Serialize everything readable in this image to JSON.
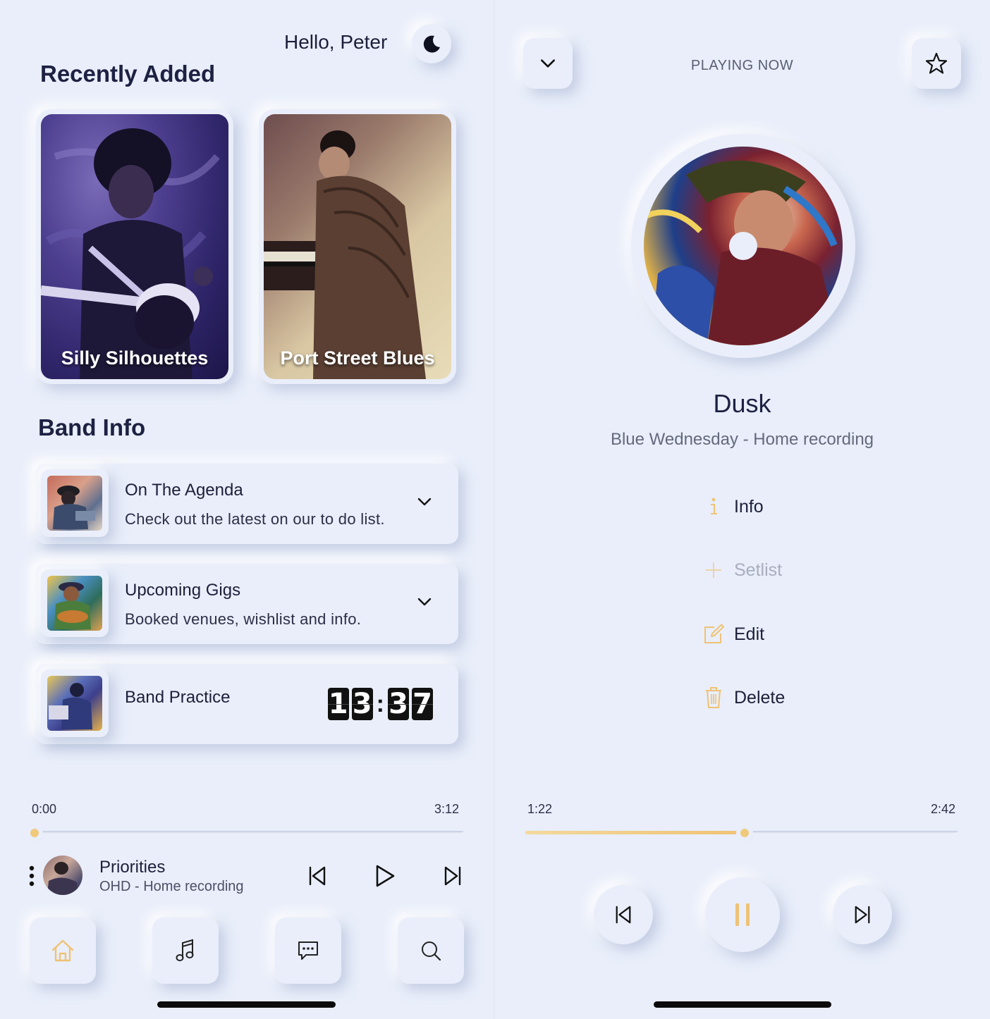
{
  "left": {
    "greeting": "Hello, Peter",
    "recently_added_title": "Recently Added",
    "albums": [
      {
        "name": "Silly Silhouettes"
      },
      {
        "name": "Port Street Blues"
      }
    ],
    "band_info_title": "Band Info",
    "cards": [
      {
        "title": "On The Agenda",
        "subtitle": "Check out the latest on our to do list."
      },
      {
        "title": "Upcoming Gigs",
        "subtitle": "Booked venues, wishlist and info."
      },
      {
        "title": "Band Practice",
        "clock": [
          "1",
          "3",
          "3",
          "7"
        ]
      }
    ],
    "player": {
      "time_start": "0:00",
      "time_end": "3:12",
      "progress": 0,
      "track_title": "Priorities",
      "track_subtitle": "OHD - Home recording"
    },
    "tabs": [
      {
        "icon": "home-icon",
        "active": true
      },
      {
        "icon": "music-note-icon",
        "active": false
      },
      {
        "icon": "chat-icon",
        "active": false
      },
      {
        "icon": "search-icon",
        "active": false
      }
    ]
  },
  "right": {
    "header_label": "PLAYING NOW",
    "song_title": "Dusk",
    "song_subtitle": "Blue Wednesday - Home recording",
    "menu": [
      {
        "icon": "info-icon",
        "label": "Info",
        "enabled": true
      },
      {
        "icon": "plus-icon",
        "label": "Setlist",
        "enabled": false
      },
      {
        "icon": "edit-icon",
        "label": "Edit",
        "enabled": true
      },
      {
        "icon": "trash-icon",
        "label": "Delete",
        "enabled": true
      }
    ],
    "player": {
      "time_current": "1:22",
      "time_total": "2:42",
      "progress": 0.506
    }
  },
  "colors": {
    "background": "#e9eefa",
    "accent": "#f0c97a",
    "text_dark": "#1d1f3a",
    "text_muted": "#65697d",
    "disabled": "#a9adbd"
  }
}
